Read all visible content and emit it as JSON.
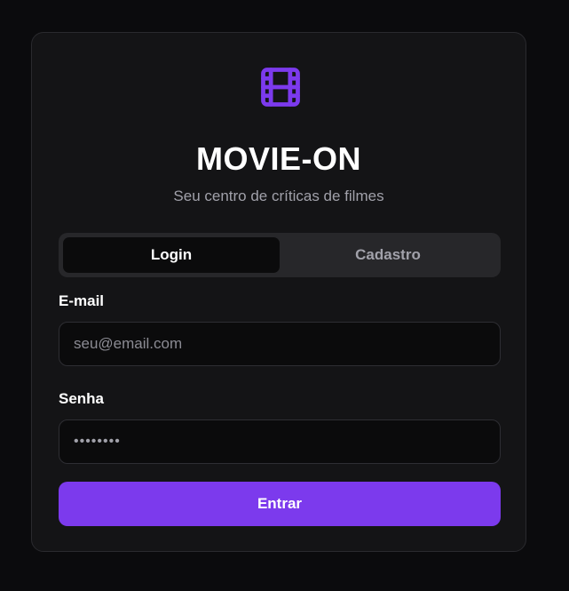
{
  "app": {
    "title": "MOVIE-ON",
    "subtitle": "Seu centro de críticas de filmes",
    "logo_icon": "film-icon",
    "accent_color": "#7c3aed"
  },
  "tabs": [
    {
      "label": "Login",
      "active": true
    },
    {
      "label": "Cadastro",
      "active": false
    }
  ],
  "form": {
    "email": {
      "label": "E-mail",
      "placeholder": "seu@email.com",
      "value": ""
    },
    "password": {
      "label": "Senha",
      "masked_value": "••••••••"
    },
    "submit_label": "Entrar"
  }
}
